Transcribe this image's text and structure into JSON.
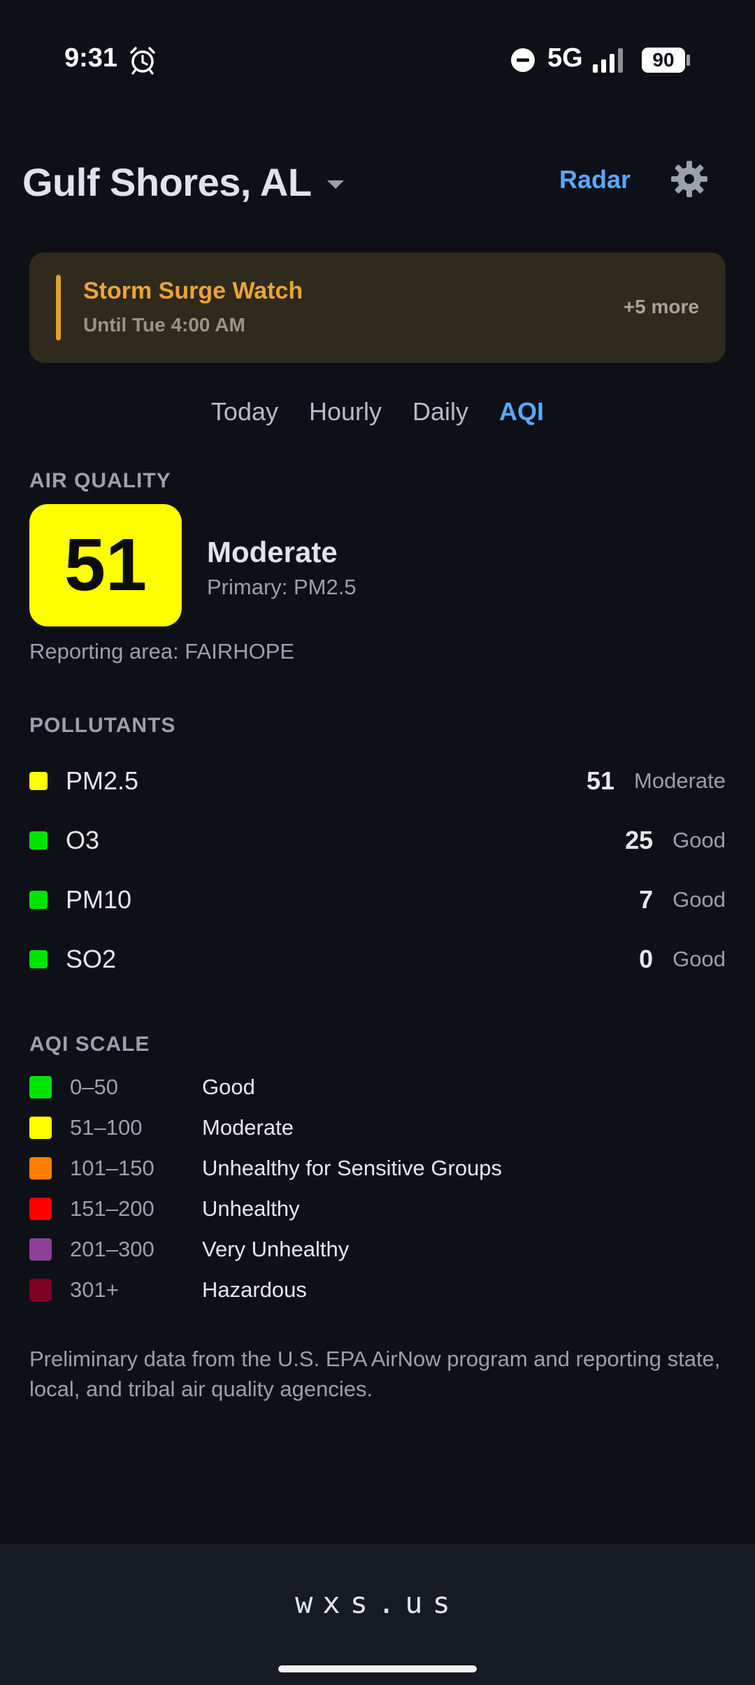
{
  "status_bar": {
    "time": "9:31",
    "network": "5G",
    "battery": "90",
    "icons": [
      "alarm-icon",
      "dnd-icon",
      "signal-icon",
      "battery-icon"
    ]
  },
  "header": {
    "location": "Gulf Shores, AL",
    "radar_label": "Radar",
    "icons": [
      "caret-down-icon",
      "gear-icon"
    ]
  },
  "alert": {
    "title": "Storm Surge Watch",
    "subtitle": "Until Tue 4:00 AM",
    "more": "+5 more",
    "accent": "#e2a02a"
  },
  "tabs": [
    {
      "label": "Today"
    },
    {
      "label": "Hourly"
    },
    {
      "label": "Daily"
    },
    {
      "label": "AQI",
      "active": true
    }
  ],
  "air_quality": {
    "section_label": "AIR QUALITY",
    "value": "51",
    "category": "Moderate",
    "primary": "Primary: PM2.5",
    "reporting_area": "Reporting area: FAIRHOPE",
    "badge_color": "#ffff00"
  },
  "pollutants": {
    "section_label": "POLLUTANTS",
    "items": [
      {
        "name": "PM2.5",
        "value": "51",
        "category": "Moderate",
        "color": "#ffff00"
      },
      {
        "name": "O3",
        "value": "25",
        "category": "Good",
        "color": "#00e400"
      },
      {
        "name": "PM10",
        "value": "7",
        "category": "Good",
        "color": "#00e400"
      },
      {
        "name": "SO2",
        "value": "0",
        "category": "Good",
        "color": "#00e400"
      }
    ]
  },
  "aqi_scale": {
    "section_label": "AQI SCALE",
    "items": [
      {
        "range": "0–50",
        "label": "Good",
        "color": "#00e400"
      },
      {
        "range": "51–100",
        "label": "Moderate",
        "color": "#ffff00"
      },
      {
        "range": "101–150",
        "label": "Unhealthy for Sensitive Groups",
        "color": "#ff7e00"
      },
      {
        "range": "151–200",
        "label": "Unhealthy",
        "color": "#ff0000"
      },
      {
        "range": "201–300",
        "label": "Very Unhealthy",
        "color": "#8f3f97"
      },
      {
        "range": "301+",
        "label": "Hazardous",
        "color": "#7e0023"
      }
    ]
  },
  "disclaimer": "Preliminary data from the U.S. EPA AirNow program and reporting state, local, and tribal air quality agencies.",
  "footer": {
    "brand": "wxs.us"
  }
}
